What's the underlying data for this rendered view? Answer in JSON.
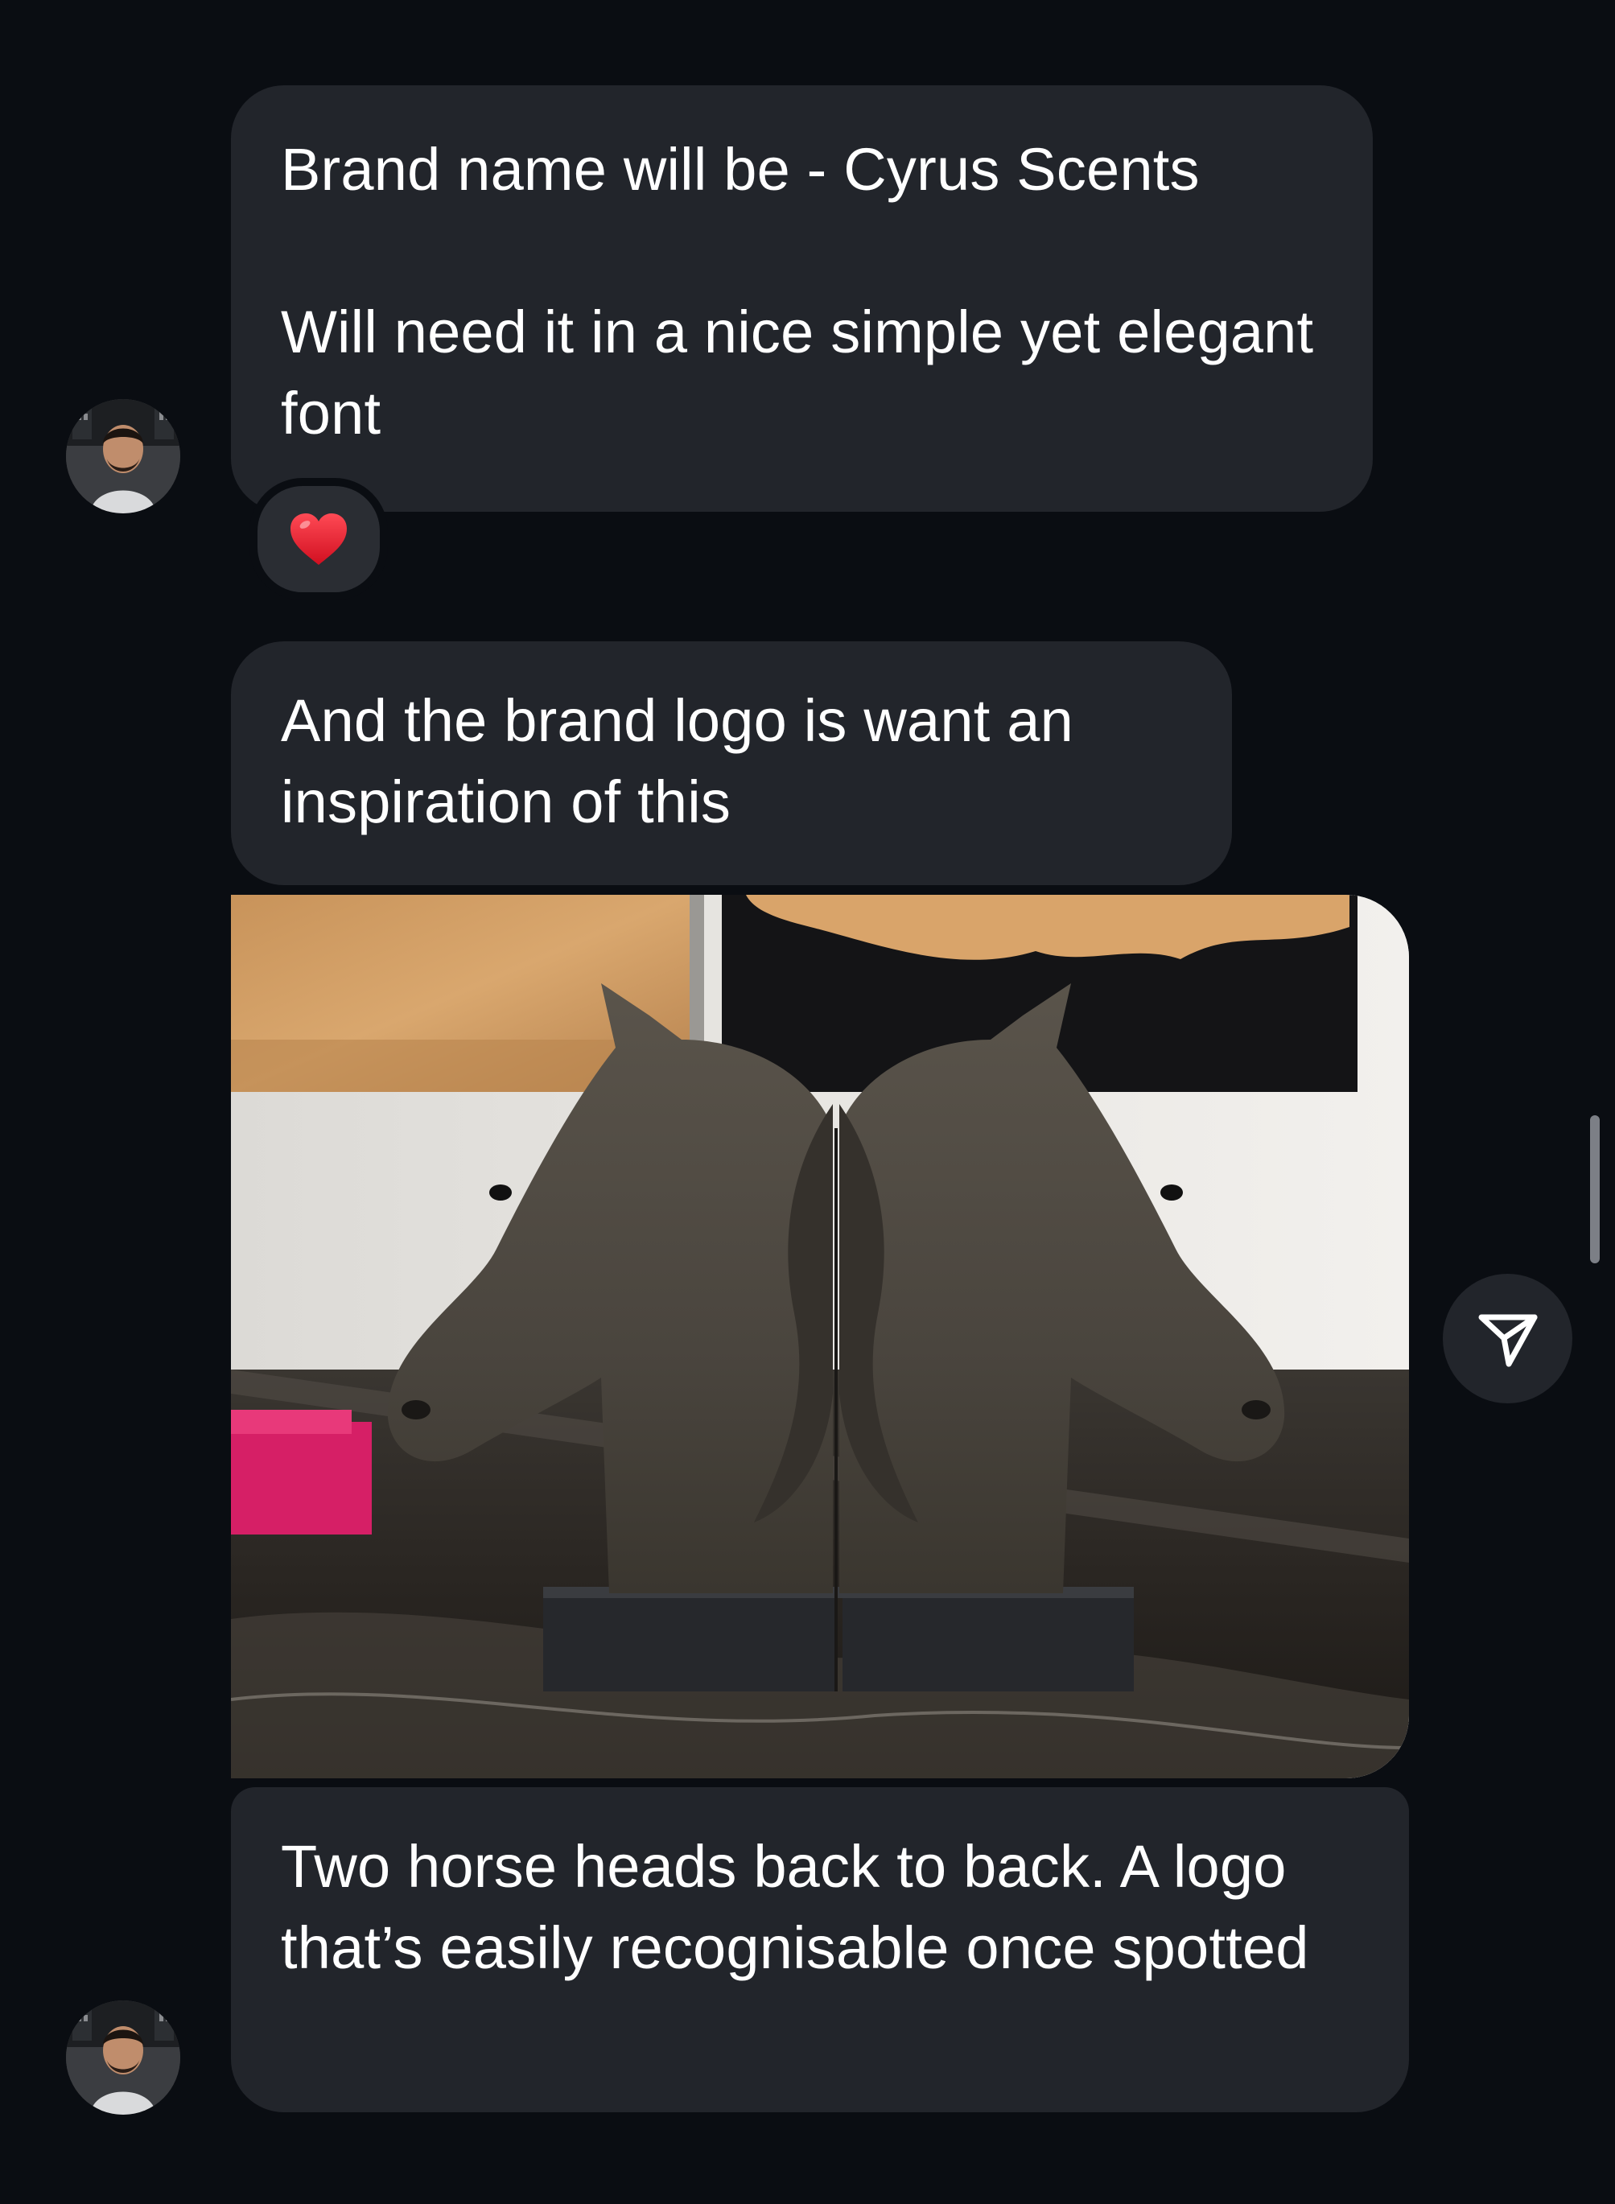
{
  "conversation": {
    "messages": [
      {
        "text": "Brand name will be - Cyrus Scents\n\nWill need it in a nice simple yet elegant font",
        "reaction": "heart"
      },
      {
        "text": "And the brand logo is want an inspiration of this"
      },
      {
        "attachment": "photo",
        "photo_description_icon": "horse-bookends-photo"
      },
      {
        "text": "Two horse heads back to back. A logo that’s easily recognisable once spotted"
      }
    ]
  },
  "icons": {
    "share": "send-icon",
    "reaction": "red-heart-icon",
    "avatar": "user-avatar"
  },
  "colors": {
    "background": "#0a0d12",
    "bubble": "#22252b",
    "text": "#ffffff",
    "heart": "#e8192c"
  }
}
